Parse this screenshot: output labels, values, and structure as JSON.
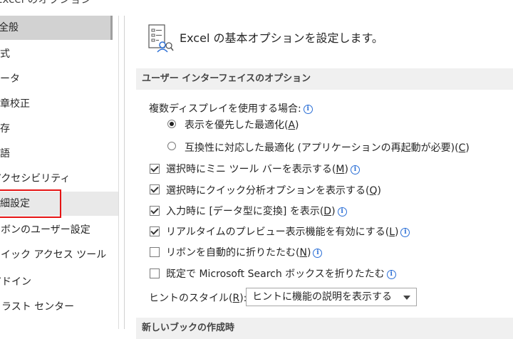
{
  "window": {
    "title": "Excel のオプション"
  },
  "sidebar": {
    "items": [
      {
        "label": "全般",
        "state": "selected"
      },
      {
        "label": "数式"
      },
      {
        "label": "データ"
      },
      {
        "label": "文章校正"
      },
      {
        "label": "保存"
      },
      {
        "label": "言語"
      },
      {
        "label": "アクセシビリティ"
      },
      {
        "label": "詳細設定",
        "state": "hover"
      },
      {
        "label": "リボンのユーザー設定"
      },
      {
        "label": "クイック アクセス ツール バー"
      },
      {
        "label": "アドイン"
      },
      {
        "label": "トラスト センター"
      }
    ]
  },
  "header": {
    "text": "Excel の基本オプションを設定します。",
    "icon": "options-icon"
  },
  "section_ui": {
    "title": "ユーザー インターフェイスのオプション",
    "multi_display_label": "複数ディスプレイを使用する場合:",
    "radio_display": "表示を優先した最適化(",
    "radio_display_key": "A",
    "radio_compat": "互換性に対応した最適化 (アプリケーションの再起動が必要)(",
    "radio_compat_key": "C",
    "mini_toolbar": "選択時にミニ ツール バーを表示する(",
    "mini_toolbar_key": "M",
    "quick_analysis": "選択時にクイック分析オプションを表示する(",
    "quick_analysis_key": "Q",
    "data_type": "入力時に [データ型に変換] を表示(",
    "data_type_key": "D",
    "live_preview": "リアルタイムのプレビュー表示機能を有効にする(",
    "live_preview_key": "L",
    "collapse_ribbon": "リボンを自動的に折りたたむ(",
    "collapse_ribbon_key": "N",
    "collapse_search": "既定で Microsoft Search ボックスを折りたたむ",
    "tooltip_style_label": "ヒントのスタイル(",
    "tooltip_style_key": "R",
    "tooltip_style_suffix": "):",
    "tooltip_style_value": "ヒントに機能の説明を表示する",
    "close_paren": ")"
  },
  "section_new": {
    "title": "新しいブックの作成時"
  },
  "colors": {
    "highlight": "#e51414",
    "info": "#2b6fd6",
    "selected": "#d2d2d2"
  }
}
